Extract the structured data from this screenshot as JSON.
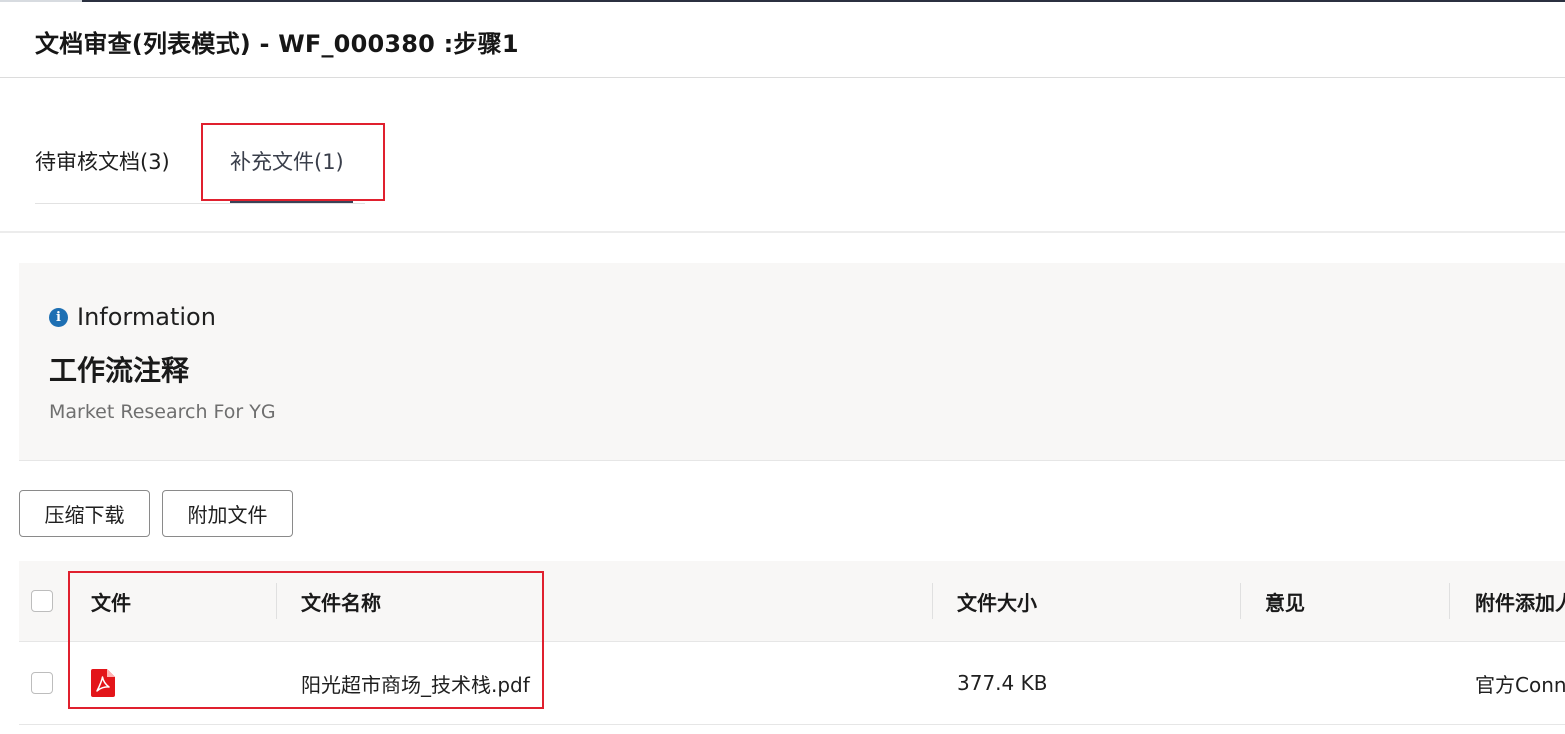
{
  "header": {
    "title": "文档审查(列表模式) - WF_000380 :步骤1"
  },
  "tabs": [
    {
      "label": "待审核文档(3)",
      "active": false
    },
    {
      "label": "补充文件(1)",
      "active": true
    }
  ],
  "info": {
    "label": "Information",
    "icon": "info-circle-icon",
    "title": "工作流注释",
    "description": "Market Research For YG"
  },
  "toolbar": {
    "zip_download_label": "压缩下载",
    "attach_file_label": "附加文件"
  },
  "table": {
    "columns": [
      "文件",
      "文件名称",
      "文件大小",
      "意见",
      "附件添加人"
    ],
    "rows": [
      {
        "file_icon": "pdf-file-icon",
        "name": "阳光超市商场_技术栈.pdf",
        "size": "377.4 KB",
        "opinion": "",
        "adder": "官方Conn"
      }
    ]
  },
  "colors": {
    "highlight": "#e0202e",
    "tab_active_underline": "#3a4257",
    "info_icon": "#1d6fb3",
    "pdf_icon": "#e3151a",
    "panel_background": "#f8f7f6"
  }
}
